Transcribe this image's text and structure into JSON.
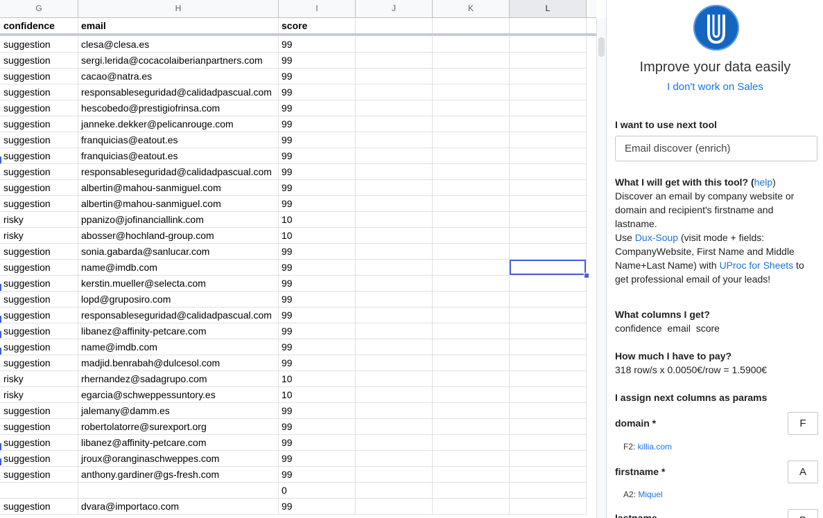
{
  "sheet": {
    "columns": [
      "G",
      "H",
      "I",
      "J",
      "K",
      "L"
    ],
    "selected_column": "L",
    "header_row": [
      "confidence",
      "email",
      "score"
    ],
    "rows": [
      [
        "suggestion",
        "clesa@clesa.es",
        "99"
      ],
      [
        "suggestion",
        "sergi.lerida@cocacolaiberianpartners.com",
        "99"
      ],
      [
        "suggestion",
        "cacao@natra.es",
        "99"
      ],
      [
        "suggestion",
        "responsableseguridad@calidadpascual.com",
        "99"
      ],
      [
        "suggestion",
        "hescobedo@prestigiofrinsa.com",
        "99"
      ],
      [
        "suggestion",
        "janneke.dekker@pelicanrouge.com",
        "99"
      ],
      [
        "suggestion",
        "franquicias@eatout.es",
        "99"
      ],
      [
        "suggestion",
        "franquicias@eatout.es",
        "99"
      ],
      [
        "suggestion",
        "responsableseguridad@calidadpascual.com",
        "99"
      ],
      [
        "suggestion",
        "albertin@mahou-sanmiguel.com",
        "99"
      ],
      [
        "suggestion",
        "albertin@mahou-sanmiguel.com",
        "99"
      ],
      [
        "risky",
        "ppanizo@jofinanciallink.com",
        "10"
      ],
      [
        "risky",
        "abosser@hochland-group.com",
        "10"
      ],
      [
        "suggestion",
        "sonia.gabarda@sanlucar.com",
        "99"
      ],
      [
        "suggestion",
        "name@imdb.com",
        "99"
      ],
      [
        "suggestion",
        "kerstin.mueller@selecta.com",
        "99"
      ],
      [
        "suggestion",
        "lopd@gruposiro.com",
        "99"
      ],
      [
        "suggestion",
        "responsableseguridad@calidadpascual.com",
        "99"
      ],
      [
        "suggestion",
        "libanez@affinity-petcare.com",
        "99"
      ],
      [
        "suggestion",
        "name@imdb.com",
        "99"
      ],
      [
        "suggestion",
        "madjid.benrabah@dulcesol.com",
        "99"
      ],
      [
        "risky",
        "rhernandez@sadagrupo.com",
        "10"
      ],
      [
        "risky",
        "egarcia@schweppessuntory.es",
        "10"
      ],
      [
        "suggestion",
        "jalemany@damm.es",
        "99"
      ],
      [
        "suggestion",
        "robertolatorre@surexport.org",
        "99"
      ],
      [
        "suggestion",
        "libanez@affinity-petcare.com",
        "99"
      ],
      [
        "suggestion",
        "jroux@oranginaschweppes.com",
        "99"
      ],
      [
        "suggestion",
        "anthony.gardiner@gs-fresh.com",
        "99"
      ],
      [
        "",
        "",
        "0"
      ],
      [
        "suggestion",
        "dvara@importaco.com",
        "99"
      ]
    ]
  },
  "panel": {
    "logo_icon": "uproc-logo-icon",
    "title": "Improve your data easily",
    "sales_link": "I don't work on Sales",
    "tool_label": "I want to use next tool",
    "tool_value": "Email discover (enrich)",
    "what_title": "What I will get with this tool? (",
    "help_link": "help",
    "what_close": ")",
    "what_desc": "Discover an email by company website or domain and recipient's firstname and lastname.",
    "use_prefix": "Use ",
    "duxsoup_link": "Dux-Soup",
    "use_mid": " (visit mode + fields: CompanyWebsite, First Name and Middle Name+Last Name) with ",
    "uproc_link": "UProc for Sheets",
    "use_suffix": " to get professional email of your leads!",
    "columns_title": "What columns I get?",
    "columns_value": "confidence  email  score",
    "pay_title": "How much I have to pay?",
    "pay_value": "318 row/s x 0.0050€/row = 1.5900€",
    "assign_title": "I assign next columns as params",
    "params": [
      {
        "label": "domain *",
        "column": "F",
        "example_prefix": "F2: ",
        "example_value": "killia.com"
      },
      {
        "label": "firstname *",
        "column": "A",
        "example_prefix": "A2: ",
        "example_value": "Miquel"
      },
      {
        "label": "lastname",
        "column": "B",
        "example_prefix": "",
        "example_value": ""
      }
    ]
  },
  "colors": {
    "accent": "#1a73e8",
    "selection": "#4a5fe0",
    "logo": "#1565c0"
  }
}
